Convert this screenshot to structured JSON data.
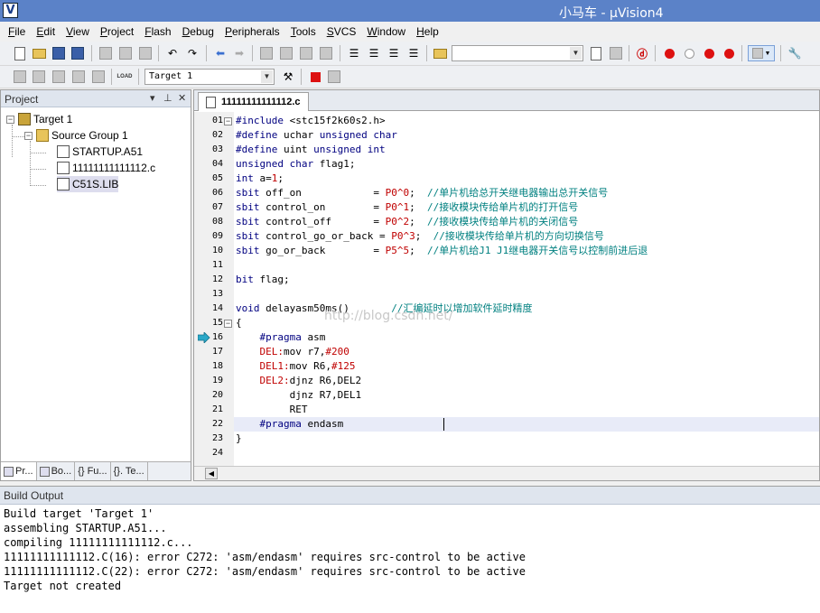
{
  "window": {
    "title": "小马车 - µVision4",
    "app_icon_glyph": "V"
  },
  "menu": [
    "File",
    "Edit",
    "View",
    "Project",
    "Flash",
    "Debug",
    "Peripherals",
    "Tools",
    "SVCS",
    "Window",
    "Help"
  ],
  "toolbar2": {
    "target_select": "Target 1",
    "load_label": "LOAD"
  },
  "project_panel": {
    "title": "Project",
    "controls": {
      "dropdown": "▾",
      "pin": "⊥",
      "close": "✕"
    },
    "tree": {
      "target": "Target 1",
      "group": "Source Group 1",
      "files": [
        "STARTUP.A51",
        "11111111111112.c",
        "C51S.LIB"
      ]
    },
    "tabs": [
      "Pr...",
      "Bo...",
      "{} Fu...",
      "{}. Te..."
    ]
  },
  "editor": {
    "tab_label": "11111111111112.c",
    "current_line": 16,
    "lines": [
      {
        "n": "01",
        "t": "#include <stc15f2k60s2.h>"
      },
      {
        "n": "02",
        "t": "#define uchar unsigned char"
      },
      {
        "n": "03",
        "t": "#define uint unsigned int"
      },
      {
        "n": "04",
        "t": "unsigned char flag1;"
      },
      {
        "n": "05",
        "t": "int a=1;"
      },
      {
        "n": "06",
        "t": "sbit off_on            = P0^0;",
        "c": "  //单片机给总开关继电器输出总开关信号"
      },
      {
        "n": "07",
        "t": "sbit control_on        = P0^1;",
        "c": "  //接收模块传给单片机的打开信号"
      },
      {
        "n": "08",
        "t": "sbit control_off       = P0^2;",
        "c": "  //接收模块传给单片机的关闭信号"
      },
      {
        "n": "09",
        "t": "sbit control_go_or_back = P0^3;",
        "c": "  //接收模块传给单片机的方向切换信号"
      },
      {
        "n": "10",
        "t": "sbit go_or_back        = P5^5;",
        "c": "  //单片机给J1 J1继电器开关信号以控制前进后退"
      },
      {
        "n": "11",
        "t": ""
      },
      {
        "n": "12",
        "t": "bit flag;"
      },
      {
        "n": "13",
        "t": ""
      },
      {
        "n": "14",
        "t": "void delayasm50ms()",
        "c": "       //汇编延时以增加软件延时精度"
      },
      {
        "n": "15",
        "t": "{"
      },
      {
        "n": "16",
        "t": "    #pragma asm"
      },
      {
        "n": "17",
        "t": "    DEL:mov r7,#200"
      },
      {
        "n": "18",
        "t": "    DEL1:mov R6,#125"
      },
      {
        "n": "19",
        "t": "    DEL2:djnz R6,DEL2"
      },
      {
        "n": "20",
        "t": "         djnz R7,DEL1"
      },
      {
        "n": "21",
        "t": "         RET"
      },
      {
        "n": "22",
        "t": "    #pragma endasm"
      },
      {
        "n": "23",
        "t": "}"
      },
      {
        "n": "24",
        "t": ""
      }
    ],
    "watermark": "http://blog.csdn.net/"
  },
  "output": {
    "title": "Build Output",
    "lines": [
      "Build target 'Target 1'",
      "assembling STARTUP.A51...",
      "compiling 11111111111112.c...",
      "11111111111112.C(16): error C272: 'asm/endasm' requires src-control to be active",
      "11111111111112.C(22): error C272: 'asm/endasm' requires src-control to be active",
      "Target not created"
    ]
  }
}
